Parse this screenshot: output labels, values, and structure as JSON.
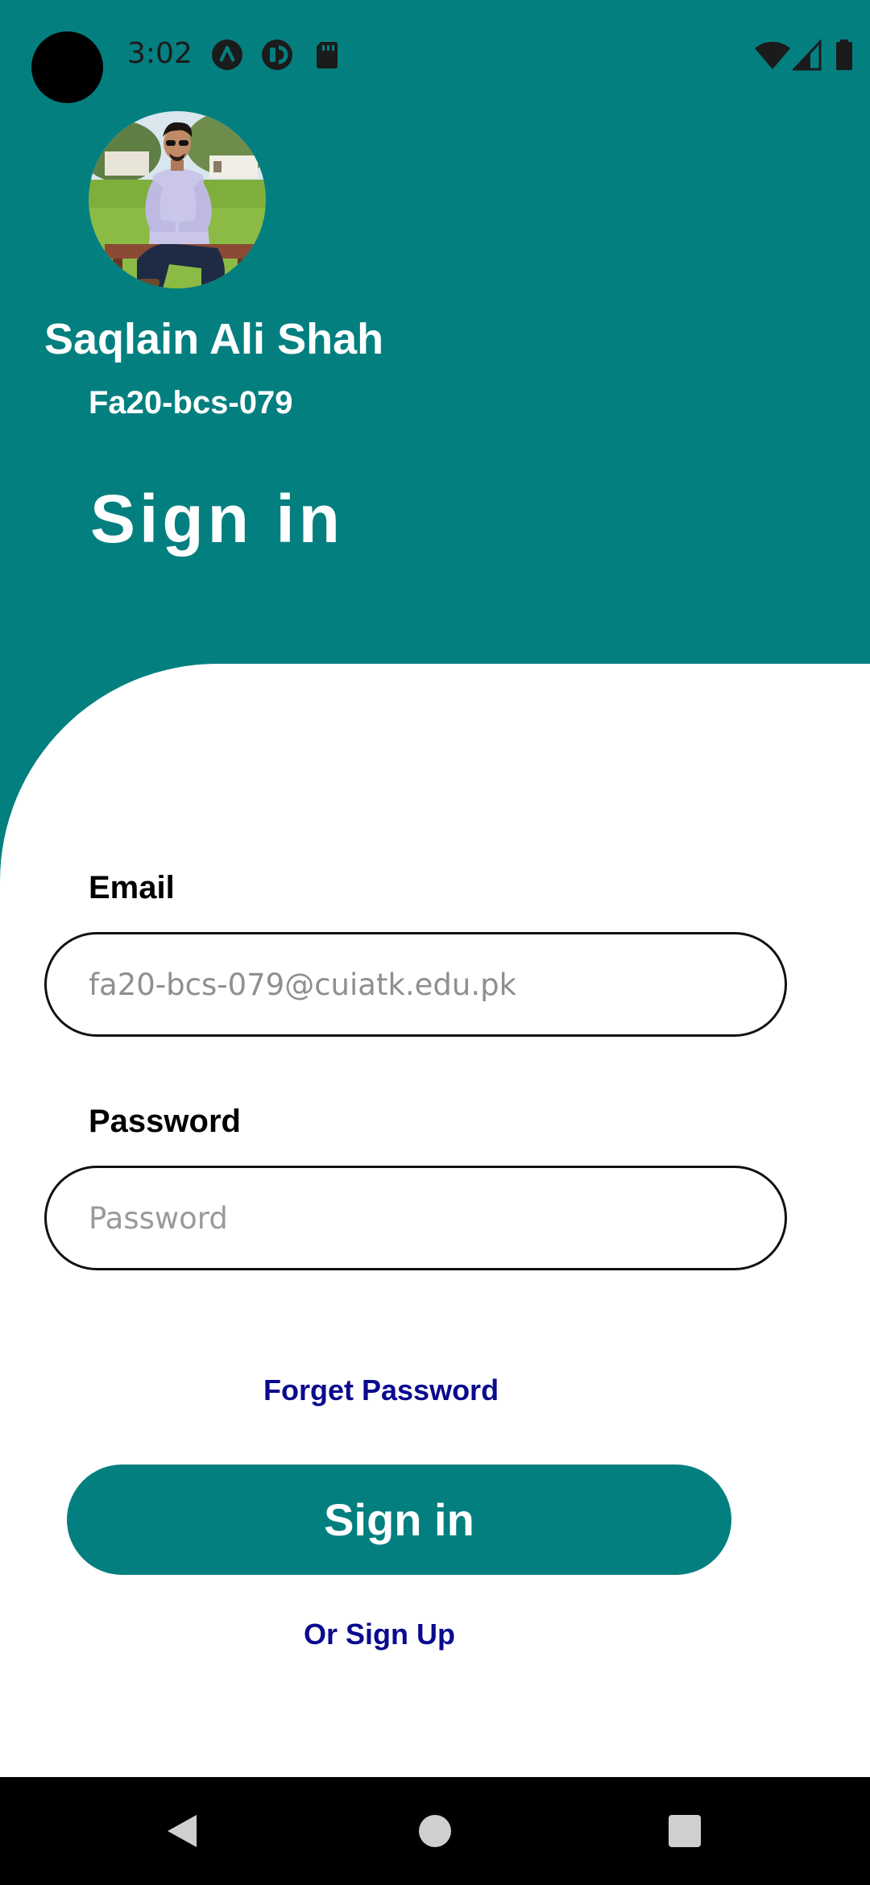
{
  "status_bar": {
    "time": "3:02",
    "icons": [
      "app-a-icon",
      "app-c-icon",
      "sd-card-icon"
    ],
    "right_icons": [
      "wifi-icon",
      "signal-icon",
      "battery-icon"
    ]
  },
  "profile": {
    "name": "Saqlain Ali Shah",
    "id": "Fa20-bcs-079",
    "avatar": "profile-photo"
  },
  "header": {
    "title": "Sign in"
  },
  "form": {
    "email_label": "Email",
    "email_value": "fa20-bcs-079@cuiatk.edu.pk",
    "email_placeholder": "",
    "password_label": "Password",
    "password_placeholder": "Password",
    "forget_password": "Forget Password",
    "submit_label": "Sign in",
    "signup_link": "Or Sign Up"
  },
  "nav": {
    "buttons": [
      "back-icon",
      "home-icon",
      "recents-icon"
    ]
  },
  "colors": {
    "primary": "#047f80",
    "link": "#0a0a8f",
    "background": "#ffffff"
  }
}
